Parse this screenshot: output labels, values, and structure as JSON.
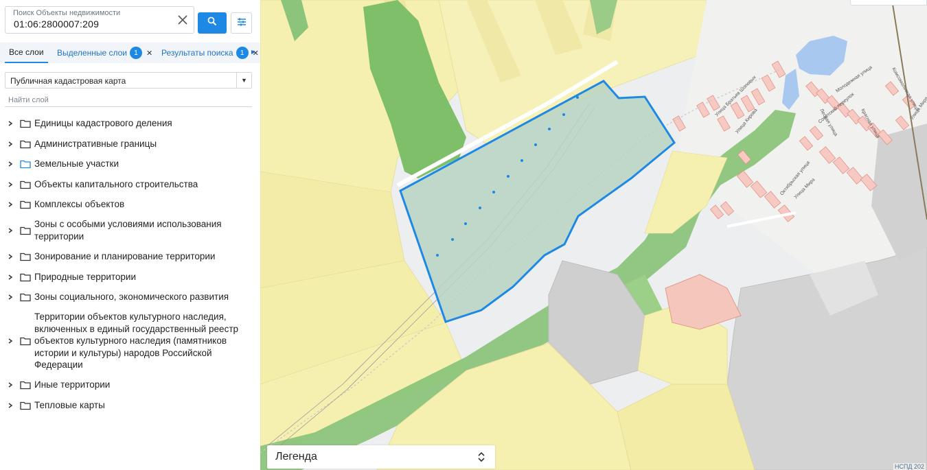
{
  "search": {
    "label": "Поиск Объекты недвижимости",
    "value": "01:06:2800007:209"
  },
  "tabs": {
    "all": "Все слои",
    "selected": {
      "label": "Выделенные слои",
      "count": "1"
    },
    "results": {
      "label": "Результаты поиска",
      "count": "1"
    }
  },
  "map_select": {
    "value": "Публичная кадастровая карта"
  },
  "layer_search": {
    "placeholder": "Найти слой"
  },
  "layers": [
    "Единицы кадастрового деления",
    "Административные границы",
    "Земельные участки",
    "Объекты капитального строительства",
    "Комплексы объектов",
    "Зоны с особыми условиями использования территории",
    "Зонирование и планирование территории",
    "Природные территории",
    "Зоны социального, экономического развития",
    "Территории объектов культурного наследия, включенных в единый государственный реестр объектов культурного наследия (памятников истории и культуры) народов Российской Федерации",
    "Иные территории",
    "Тепловые карты"
  ],
  "legend": {
    "title": "Легенда"
  },
  "attribution": "НСПД 202",
  "streets": [
    "Улица Кирова",
    "Молодежная улица",
    "Советский переулок",
    "Октябрьская улица",
    "Улица Мира",
    "Комсомольская улица",
    "Улица Мира",
    "Улица Братьев Шоловых",
    "Красная улица",
    "Лесная улица"
  ],
  "colors": {
    "accent": "#1e88e5",
    "parcel_outline": "#1e88e5",
    "parcel_fill": "#b9d3c2",
    "land_yellow": "#f6f1b5",
    "forest_green": "#8cc47b",
    "building_pink": "#f7c9c3",
    "water": "#a9c8f0",
    "industrial_gray": "#d4d4d4"
  }
}
